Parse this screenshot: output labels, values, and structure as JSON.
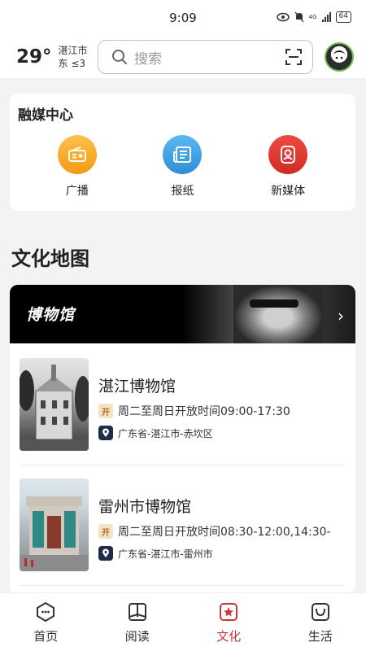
{
  "status_bar": {
    "time": "9:09",
    "battery": "64",
    "network": "4G"
  },
  "header": {
    "temperature": "29°",
    "city": "湛江市",
    "wind": "东  ≤3",
    "search_placeholder": "搜索"
  },
  "media_center": {
    "title": "融媒中心",
    "items": [
      {
        "label": "广播",
        "color": "#f5a623",
        "icon": "radio-icon"
      },
      {
        "label": "报纸",
        "color": "#3b9fe3",
        "icon": "newspaper-icon"
      },
      {
        "label": "新媒体",
        "color": "#e0342f",
        "icon": "new-media-icon"
      }
    ]
  },
  "culture_map": {
    "title": "文化地图",
    "banner_title": "博物馆",
    "museums": [
      {
        "name": "湛江博物馆",
        "hours_badge": "开",
        "hours": "周二至周日开放时间09:00-17:30",
        "location": "广东省-湛江市-赤坎区"
      },
      {
        "name": "雷州市博物馆",
        "hours_badge": "开",
        "hours": "周二至周日开放时间08:30-12:00,14:30-",
        "location": "广东省-湛江市-雷州市"
      }
    ]
  },
  "bottom_nav": {
    "active": "文化",
    "active_color": "#c8373e",
    "items": [
      {
        "label": "首页",
        "icon": "home-icon"
      },
      {
        "label": "阅读",
        "icon": "book-icon"
      },
      {
        "label": "文化",
        "icon": "culture-icon"
      },
      {
        "label": "生活",
        "icon": "life-icon"
      }
    ]
  }
}
